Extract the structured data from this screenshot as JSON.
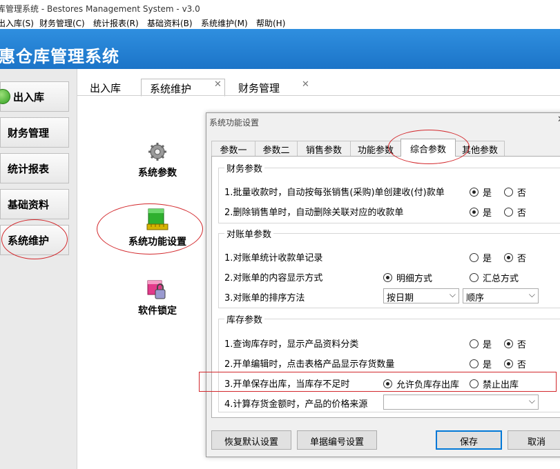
{
  "window": {
    "title": "库管理系统 - Bestores Management System - v3.0"
  },
  "menu": [
    "出入库(S)",
    "财务管理(C)",
    "统计报表(R)",
    "基础资料(B)",
    "系统维护(M)",
    "帮助(H)"
  ],
  "banner": {
    "title": "惠仓库管理系统"
  },
  "sidebar": {
    "items": [
      "出入库",
      "财务管理",
      "统计报表",
      "基础资料",
      "系统维护"
    ]
  },
  "tabs": [
    "出入库",
    "系统维护",
    "财务管理"
  ],
  "tools": [
    "系统参数",
    "系统功能设置",
    "软件锁定"
  ],
  "dialog": {
    "title": "系统功能设置",
    "tabs": [
      "参数一",
      "参数二",
      "销售参数",
      "功能参数",
      "综合参数",
      "其他参数"
    ],
    "groups": {
      "finance": "财务参数",
      "statement": "对账单参数",
      "stock": "库存参数"
    },
    "rows": {
      "f1": "1.批量收款时，自动按每张销售(采购)单创建收(付)款单",
      "f2": "2.删除销售单时，自动删除关联对应的收款单",
      "s1": "1.对账单统计收款单记录",
      "s2": "2.对账单的内容显示方式",
      "s3": "3.对账单的排序方法",
      "k1": "1.查询库存时，显示产品资料分类",
      "k2": "2.开单编辑时，点击表格产品显示存货数量",
      "k3": "3.开单保存出库，当库存不足时",
      "k4": "4.计算存货金额时，产品的价格来源"
    },
    "options": {
      "yes": "是",
      "no": "否",
      "detail": "明细方式",
      "summary": "汇总方式",
      "allow": "允许负库存出库",
      "forbid": "禁止出库"
    },
    "selects": {
      "sort_by": "按日期",
      "order": "顺序",
      "price_source": ""
    },
    "buttons": {
      "restore": "恢复默认设置",
      "numbering": "单据编号设置",
      "save": "保存",
      "cancel": "取消"
    }
  },
  "colors": {
    "banner": "#1c74c8",
    "annotation": "#d2262a"
  }
}
